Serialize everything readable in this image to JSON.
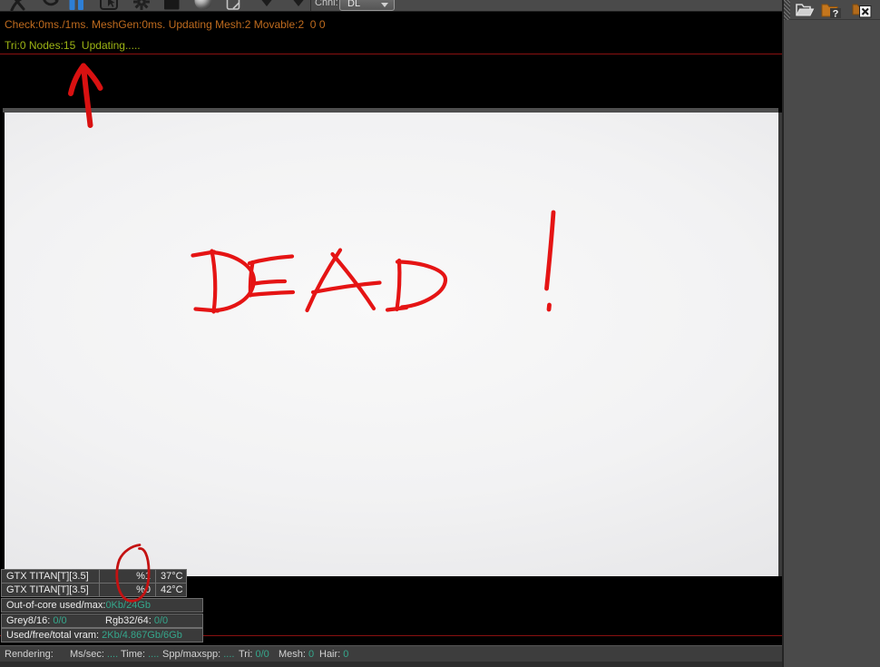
{
  "toolbar": {
    "channel_label": "Chnl:",
    "channel_value": "DL"
  },
  "messages": {
    "check_line": "Check:0ms./1ms. MeshGen:0ms. Updating Mesh:2 Movable:2  0 0",
    "tri_line": "Tri:0 Nodes:15  Updating....."
  },
  "annotations": {
    "word": "DEAD !",
    "color": "#e01414"
  },
  "gpu_table": {
    "rows": [
      {
        "name": "GTX TITAN[T][3.5]",
        "load": "%1",
        "temp": "37°C"
      },
      {
        "name": "GTX TITAN[T][3.5]",
        "load": "%0",
        "temp": "42°C"
      }
    ],
    "out_of_core_label": "Out-of-core used/max:",
    "out_of_core_value": "0Kb/24Gb",
    "grey_label": "Grey8/16:",
    "grey_value": "0/0",
    "rgb_label": "Rgb32/64:",
    "rgb_value": "0/0",
    "vram_label": "Used/free/total vram:",
    "vram_value": "2Kb/4.867Gb/6Gb"
  },
  "status_bar": {
    "rendering_label": "Rendering:",
    "ms_label": "Ms/sec:",
    "ms_value": "....",
    "time_label": "Time:",
    "time_value": "....",
    "spp_label": "Spp/maxspp:",
    "spp_value": "....",
    "tri_label": "Tri:",
    "tri_value": "0/0",
    "mesh_label": "Mesh:",
    "mesh_value": "0",
    "hair_label": "Hair:",
    "hair_value": "0"
  },
  "colors": {
    "warning_text": "#bf6b1e",
    "status_text": "#9db414",
    "value_teal": "#35a78c",
    "divider_red": "#8a1010",
    "annotation_red": "#e01414",
    "pause_blue": "#2e7fd6"
  }
}
